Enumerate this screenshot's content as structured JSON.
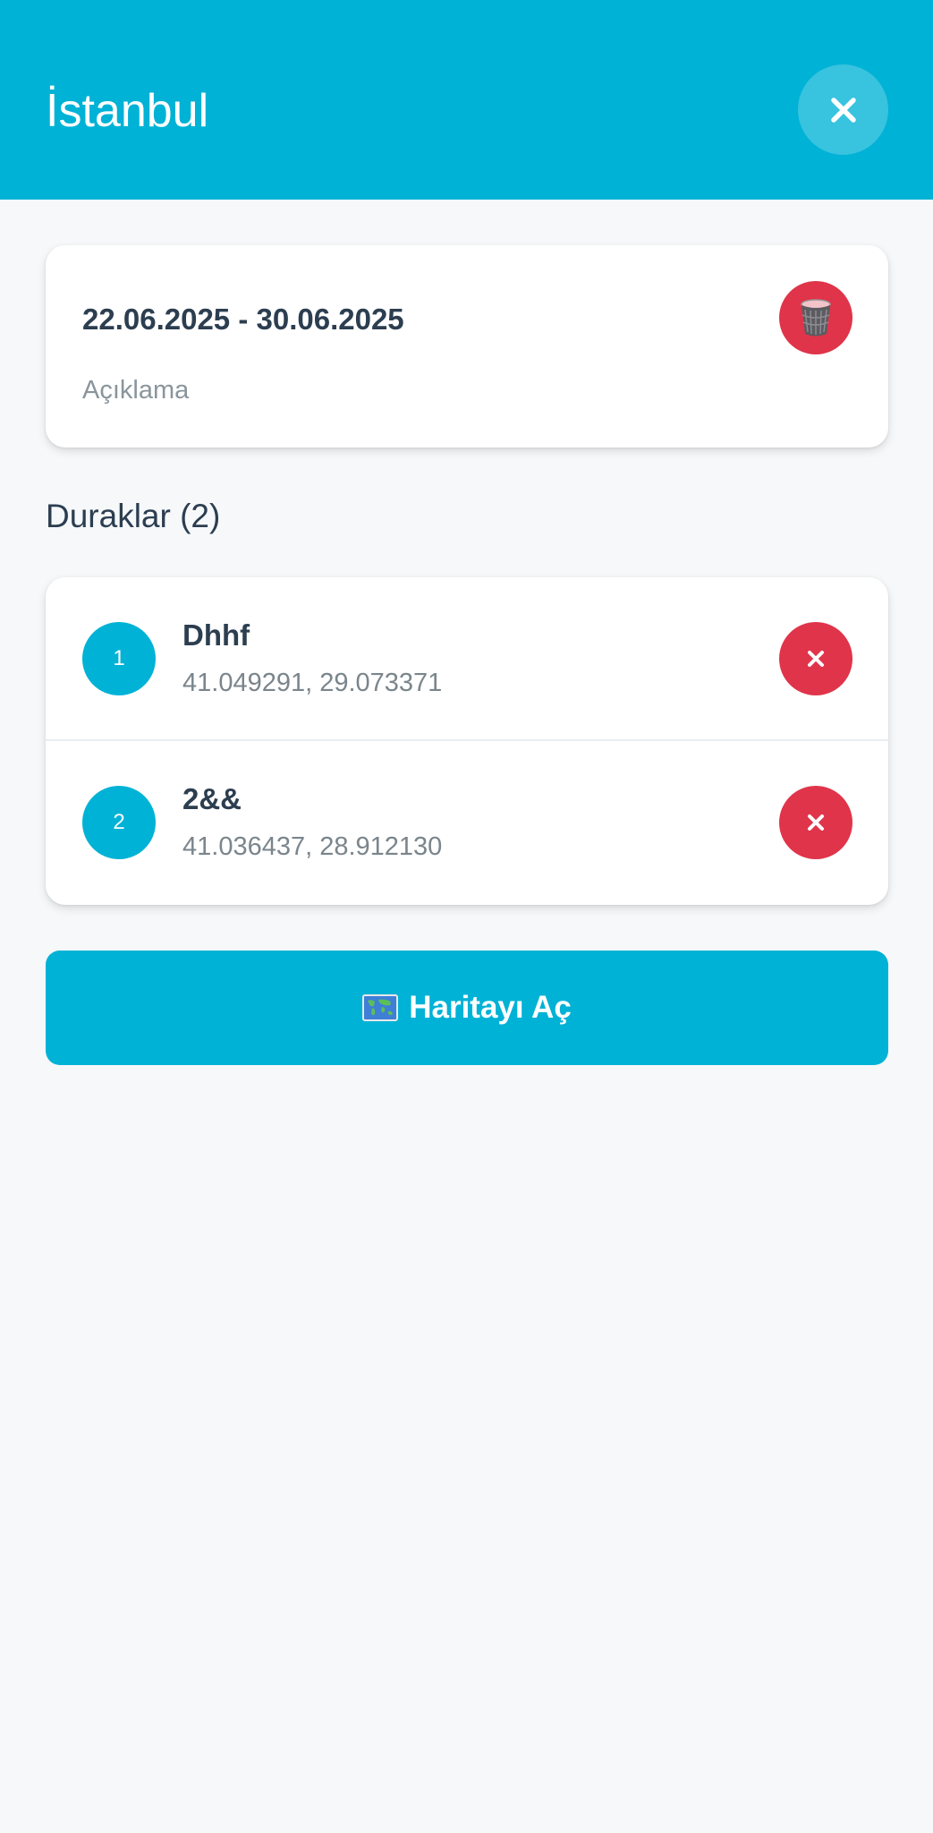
{
  "header": {
    "title": "İstanbul",
    "close_icon": "close-icon"
  },
  "trip": {
    "dates": "22.06.2025 - 30.06.2025",
    "description": "Açıklama",
    "delete_icon": "trash-icon"
  },
  "stops_section": {
    "title": "Duraklar (2)"
  },
  "stops": [
    {
      "number": "1",
      "name": "Dhhf",
      "coords": "41.049291, 29.073371"
    },
    {
      "number": "2",
      "name": "2&&",
      "coords": "41.036437, 28.912130"
    }
  ],
  "map_button": {
    "label": "Haritayı Aç",
    "icon": "world-map-icon"
  },
  "colors": {
    "primary": "#00b2d6",
    "danger": "#e0344a",
    "background": "#f6f8fa",
    "text": "#2c3e50"
  }
}
